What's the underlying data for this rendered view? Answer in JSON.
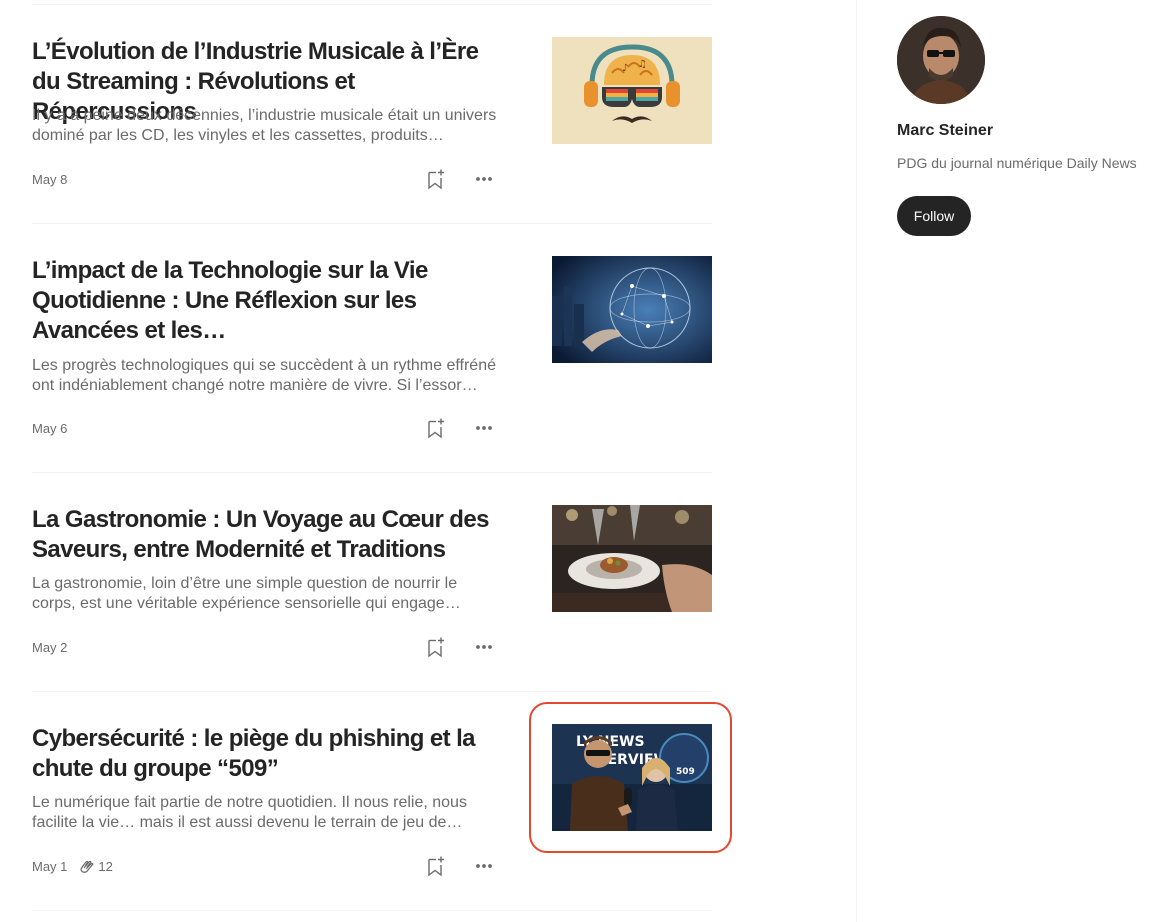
{
  "articles": [
    {
      "title": "L’Évolution de l’Industrie Musicale à l’Ère du Streaming : Révolutions et Répercussions",
      "excerpt": "Il y a à peine deux décennies, l’industrie musicale était un univers dominé par les CD, les vinyles et les cassettes, produits…",
      "date": "May 8",
      "claps": "",
      "thumb_icon": "music-brain-headphones-illustration"
    },
    {
      "title": "L’impact de la Technologie sur la Vie Quotidienne : Une Réflexion sur les Avancées et les…",
      "excerpt": "Les progrès technologiques qui se succèdent à un rythme effréné ont indéniablement changé notre manière de vivre. Si l’essor des…",
      "date": "May 6",
      "claps": "",
      "thumb_icon": "digital-globe-network-photo"
    },
    {
      "title": "La Gastronomie : Un Voyage au Cœur des Saveurs, entre Modernité et Traditions",
      "excerpt": "La gastronomie, loin d’être une simple question de nourrir le corps, est une véritable expérience sensorielle qui engage…",
      "date": "May 2",
      "claps": "",
      "thumb_icon": "restaurant-plate-photo"
    },
    {
      "title": "Cybersécurité : le piège du phishing et la chute du groupe “509”",
      "excerpt": "Le numérique fait partie de notre quotidien. Il nous relie, nous facilite la vie… mais il est aussi devenu le terrain de jeu de…",
      "date": "May 1",
      "claps": "12",
      "thumb_icon": "news-interview-photo",
      "thumb_text": {
        "banner_line1": "LY NEWS",
        "banner_line2": "TERVIEW",
        "badge": "509"
      }
    }
  ],
  "profile": {
    "name": "Marc Steiner",
    "bio": "PDG du journal numérique Daily News",
    "follow_label": "Follow"
  },
  "colors": {
    "text": "#242424",
    "muted": "#6b6b6b",
    "highlight": "#e2492f",
    "button": "#242424"
  }
}
